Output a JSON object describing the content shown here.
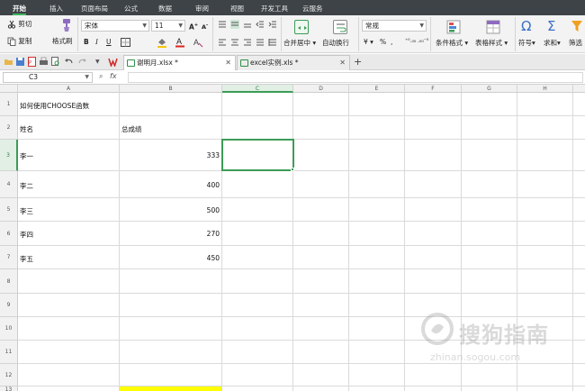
{
  "menu": {
    "tabs": [
      "开始",
      "插入",
      "页面布局",
      "公式",
      "数据",
      "审阅",
      "视图",
      "开发工具",
      "云服务"
    ],
    "active": "开始"
  },
  "ribbon": {
    "cut": "剪切",
    "copy": "复制",
    "format_painter": "格式刷",
    "font_name": "宋体",
    "font_size": "11",
    "bold": "B",
    "italic": "I",
    "underline": "U",
    "merge_center": "合并居中",
    "wrap_text": "自动换行",
    "number_format": "常规",
    "currency": "¥",
    "percent": "%",
    "thousands": ",",
    "conditional_format": "条件格式",
    "table_style": "表格样式",
    "symbol": "符号",
    "sum": "求和",
    "filter": "筛选",
    "symbol_glyph": "Ω",
    "sum_glyph": "Σ"
  },
  "documents": [
    {
      "name": "谢明月.xlsx *",
      "active": true
    },
    {
      "name": "excel实例.xls *",
      "active": false
    }
  ],
  "new_tab": "+",
  "formula_bar": {
    "name_box": "C3",
    "fx": "fx",
    "value": ""
  },
  "grid": {
    "columns": [
      "A",
      "B",
      "C",
      "D",
      "E",
      "F",
      "G",
      "H"
    ],
    "rows": [
      "1",
      "2",
      "3",
      "4",
      "5",
      "6",
      "7",
      "8",
      "9",
      "10",
      "11",
      "12",
      "13"
    ],
    "selected_cell": "C3",
    "cells": {
      "a1": "如何使用CHOOSE函数",
      "a2": "姓名",
      "b2": "总成绩",
      "a3": "李一",
      "b3": "333",
      "a4": "李二",
      "b4": "400",
      "a5": "李三",
      "b5": "500",
      "a6": "李四",
      "b6": "270",
      "a7": "李五",
      "b7": "450"
    }
  },
  "watermark": {
    "text": "搜狗指南",
    "url": "zhinan.sogou.com"
  },
  "colors": {
    "accent": "#3c9c57",
    "menu_bg": "#3e4347",
    "highlight": "#ffff00"
  }
}
